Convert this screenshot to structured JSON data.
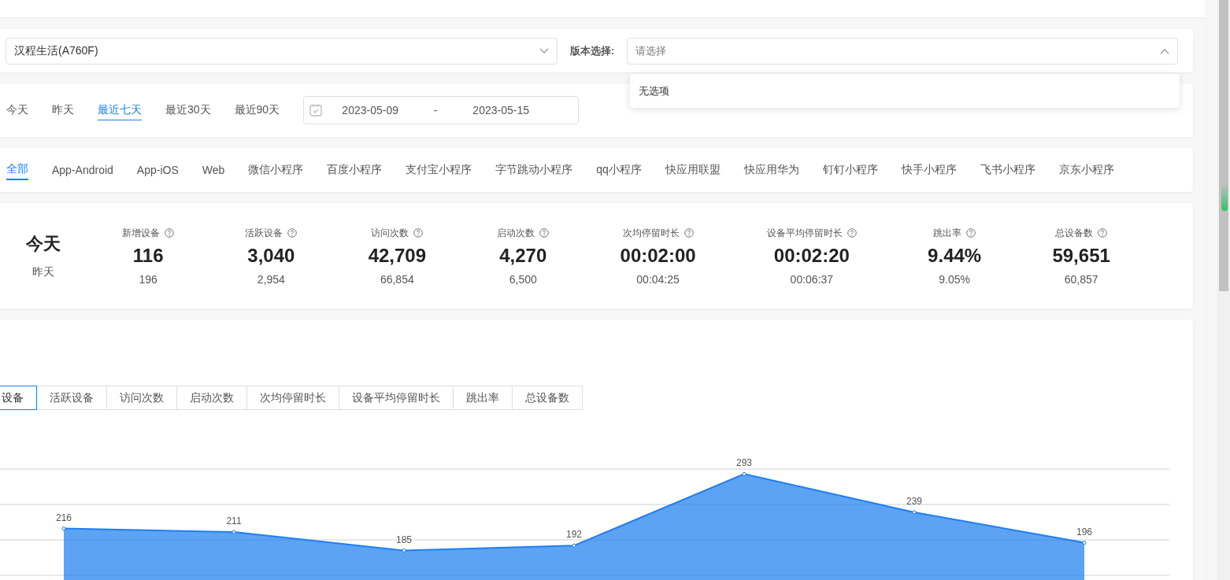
{
  "device_select": {
    "value": "汉程生活(A760F)"
  },
  "version_select": {
    "label": "版本选择:",
    "placeholder": "请选择",
    "expanded": true,
    "empty_text": "无选项"
  },
  "date_ranges": [
    {
      "label": "今天",
      "selected": false
    },
    {
      "label": "昨天",
      "selected": false
    },
    {
      "label": "最近七天",
      "selected": true
    },
    {
      "label": "最近30天",
      "selected": false
    },
    {
      "label": "最近90天",
      "selected": false
    }
  ],
  "date_picker": {
    "start": "2023-05-09",
    "separator": "-",
    "end": "2023-05-15"
  },
  "platform_tabs": [
    {
      "label": "全部",
      "selected": true
    },
    {
      "label": "App-Android",
      "selected": false
    },
    {
      "label": "App-iOS",
      "selected": false
    },
    {
      "label": "Web",
      "selected": false
    },
    {
      "label": "微信小程序",
      "selected": false
    },
    {
      "label": "百度小程序",
      "selected": false
    },
    {
      "label": "支付宝小程序",
      "selected": false
    },
    {
      "label": "字节跳动小程序",
      "selected": false
    },
    {
      "label": "qq小程序",
      "selected": false
    },
    {
      "label": "快应用联盟",
      "selected": false
    },
    {
      "label": "快应用华为",
      "selected": false
    },
    {
      "label": "钉钉小程序",
      "selected": false
    },
    {
      "label": "快手小程序",
      "selected": false
    },
    {
      "label": "飞书小程序",
      "selected": false
    },
    {
      "label": "京东小程序",
      "selected": false
    }
  ],
  "stats": {
    "today_label": "今天",
    "yesterday_label": "昨天",
    "metrics": [
      {
        "name": "新增设备",
        "value": "116",
        "previous": "196"
      },
      {
        "name": "活跃设备",
        "value": "3,040",
        "previous": "2,954"
      },
      {
        "name": "访问次数",
        "value": "42,709",
        "previous": "66,854"
      },
      {
        "name": "启动次数",
        "value": "4,270",
        "previous": "6,500"
      },
      {
        "name": "次均停留时长",
        "value": "00:02:00",
        "previous": "00:04:25"
      },
      {
        "name": "设备平均停留时长",
        "value": "00:02:20",
        "previous": "00:06:37"
      },
      {
        "name": "跳出率",
        "value": "9.44%",
        "previous": "9.05%"
      },
      {
        "name": "总设备数",
        "value": "59,651",
        "previous": "60,857"
      }
    ]
  },
  "metric_tabs": [
    {
      "label": "设备",
      "selected": true
    },
    {
      "label": "活跃设备",
      "selected": false
    },
    {
      "label": "访问次数",
      "selected": false
    },
    {
      "label": "启动次数",
      "selected": false
    },
    {
      "label": "次均停留时长",
      "selected": false
    },
    {
      "label": "设备平均停留时长",
      "selected": false
    },
    {
      "label": "跳出率",
      "selected": false
    },
    {
      "label": "总设备数",
      "selected": false
    }
  ],
  "chart_data": {
    "type": "area",
    "categories": [
      null,
      null,
      null,
      null,
      null,
      null,
      null
    ],
    "series": [
      {
        "color": "#1e7ff0",
        "values": [
          216,
          211,
          185,
          192,
          293,
          239,
          196
        ]
      }
    ],
    "data_labels": true
  }
}
